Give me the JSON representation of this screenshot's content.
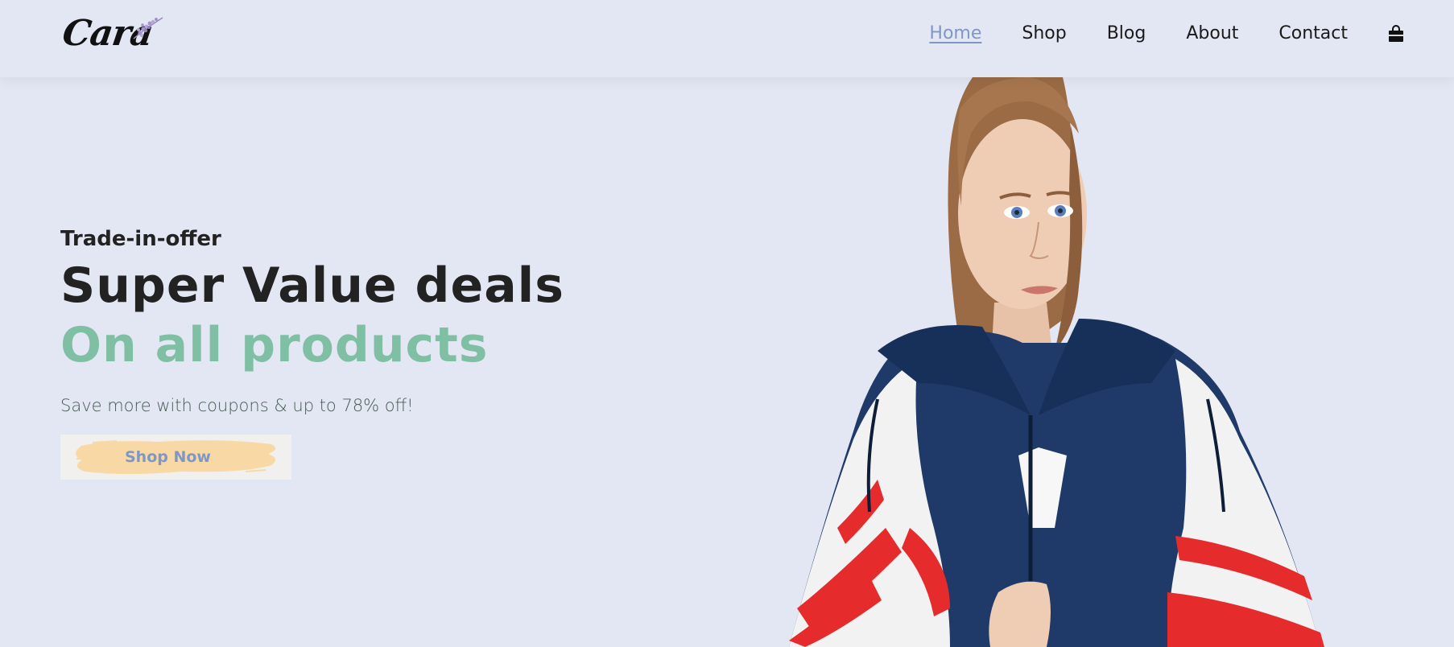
{
  "brand": {
    "logo_text": "Cara",
    "accent_color": "#7FBFA3",
    "link_active_color": "#7E97C4",
    "background_color": "#E3E6F3"
  },
  "nav": {
    "items": [
      {
        "label": "Home",
        "active": true
      },
      {
        "label": "Shop",
        "active": false
      },
      {
        "label": "Blog",
        "active": false
      },
      {
        "label": "About",
        "active": false
      },
      {
        "label": "Contact",
        "active": false
      }
    ],
    "cart_icon": "shopping-bag-icon"
  },
  "hero": {
    "kicker": "Trade-in-offer",
    "title_line1": "Super Value deals",
    "title_line2": "On all products",
    "subtitle": "Save more with coupons & up to 78% off!",
    "cta_label": "Shop Now"
  }
}
